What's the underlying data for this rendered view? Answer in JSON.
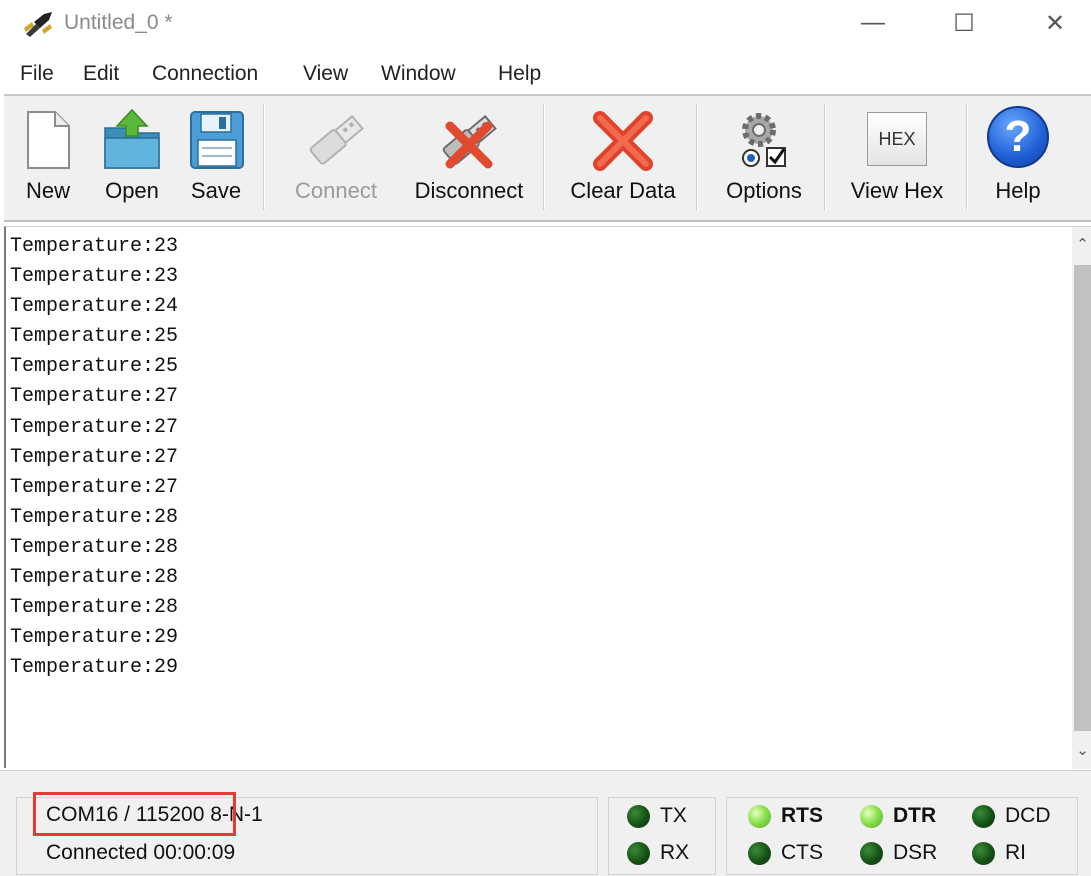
{
  "window": {
    "title": "Untitled_0 *",
    "minimize": "—",
    "maximize": "☐",
    "close": "✕"
  },
  "menu": [
    "File",
    "Edit",
    "Connection",
    "View",
    "Window",
    "Help"
  ],
  "toolbar": {
    "new": "New",
    "open": "Open",
    "save": "Save",
    "connect": "Connect",
    "disconnect": "Disconnect",
    "clear_data": "Clear Data",
    "options": "Options",
    "view_hex": "View Hex",
    "hex_icon_text": "HEX",
    "help": "Help",
    "help_icon_text": "?"
  },
  "terminal": {
    "lines": [
      "Temperature:23",
      "Temperature:23",
      "Temperature:24",
      "Temperature:25",
      "Temperature:25",
      "Temperature:27",
      "Temperature:27",
      "Temperature:27",
      "Temperature:27",
      "Temperature:28",
      "Temperature:28",
      "Temperature:28",
      "Temperature:28",
      "Temperature:29",
      "Temperature:29"
    ]
  },
  "status": {
    "port": "COM16 / 115200 8-N-1",
    "connection": "Connected 00:00:09",
    "highlight_color": "#e53935"
  },
  "signals": {
    "tx": {
      "label": "TX",
      "state": "off"
    },
    "rx": {
      "label": "RX",
      "state": "off"
    },
    "rts": {
      "label": "RTS",
      "state": "on"
    },
    "cts": {
      "label": "CTS",
      "state": "off"
    },
    "dtr": {
      "label": "DTR",
      "state": "on"
    },
    "dsr": {
      "label": "DSR",
      "state": "off"
    },
    "dcd": {
      "label": "DCD",
      "state": "off"
    },
    "ri": {
      "label": "RI",
      "state": "off"
    }
  }
}
